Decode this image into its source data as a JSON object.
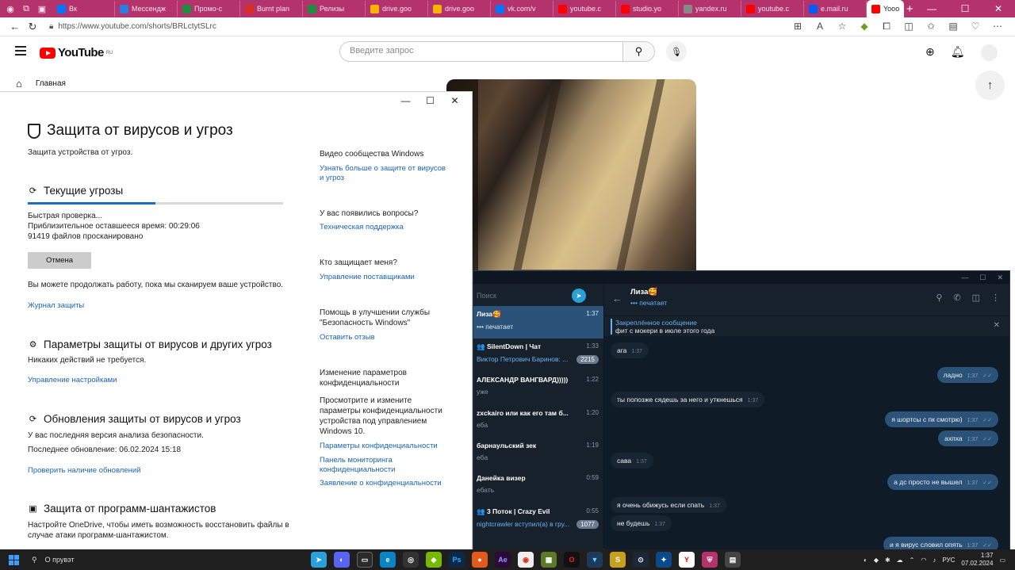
{
  "browser": {
    "tabs": [
      {
        "label": "Вк",
        "color": "#0077ff"
      },
      {
        "label": "Мессендж",
        "color": "#2a7de1"
      },
      {
        "label": "Промо-с",
        "color": "#1e8e3e"
      },
      {
        "label": "Burnt plan",
        "color": "#d93025"
      },
      {
        "label": "Релизы",
        "color": "#1e8e3e"
      },
      {
        "label": "drive.goo",
        "color": "#f4b400"
      },
      {
        "label": "drive.goo",
        "color": "#f4b400"
      },
      {
        "label": "vk.com/v",
        "color": "#0077ff"
      },
      {
        "label": "youtube.c",
        "color": "#ff0000"
      },
      {
        "label": "studio.yo",
        "color": "#ff0000"
      },
      {
        "label": "yandex.ru",
        "color": "#888888"
      },
      {
        "label": "youtube.c",
        "color": "#ff0000"
      },
      {
        "label": "e.mail.ru",
        "color": "#005ff9"
      }
    ],
    "active_tab": "Yooo",
    "url": "https://www.youtube.com/shorts/BRLctytSLrc"
  },
  "youtube": {
    "logo": "YouTube",
    "region": "RU",
    "search_placeholder": "Введите запрос",
    "home_label": "Главная"
  },
  "security": {
    "title": "Защита от вирусов и угроз",
    "subtitle": "Защита устройства от угроз.",
    "threats_heading": "Текущие угрозы",
    "scan_progress": 0.5,
    "scan_line1": "Быстрая проверка...",
    "scan_line2": "Приблизительное оставшееся время:  00:29:06",
    "scan_line3": "91419  файлов просканировано",
    "cancel_label": "Отмена",
    "continue_text": "Вы можете продолжать работу, пока мы сканируем ваше устройство.",
    "journal_link": "Журнал защиты",
    "settings_heading": "Параметры защиты от вирусов и других угроз",
    "settings_text": "Никаких действий не требуется.",
    "settings_link": "Управление настройками",
    "updates_heading": "Обновления защиты от вирусов и угроз",
    "updates_text1": "У вас последняя версия анализа безопасности.",
    "updates_text2": "Последнее обновление: 06.02.2024 15:18",
    "updates_link": "Проверить наличие обновлений",
    "ransom_heading": "Защита от программ-шантажистов",
    "ransom_text": "Настройте OneDrive, чтобы иметь возможность восстановить файлы в случае атаки программ-шантажистом.",
    "side": {
      "video_title": "Видео сообщества Windows",
      "video_link": "Узнать больше о защите от вирусов и угроз",
      "questions_title": "У вас появились вопросы?",
      "questions_link": "Техническая поддержка",
      "who_title": "Кто защищает меня?",
      "who_link": "Управление поставщиками",
      "help_title": "Помощь в улучшении службы \"Безопасность Windows\"",
      "help_link": "Оставить отзыв",
      "privacy_title": "Изменение параметров конфиденциальности",
      "privacy_text": "Просмотрите и измените параметры конфиденциальности устройства под управлением Windows 10.",
      "privacy_link1": "Параметры конфиденциальности",
      "privacy_link2": "Панель мониторинга конфиденциальности",
      "privacy_link3": "Заявление о конфиденциальности"
    }
  },
  "telegram": {
    "search_placeholder": "Поиск",
    "chats": [
      {
        "name": "Лиза🥰",
        "preview": "••• печатает",
        "time": "1:37",
        "badge": "",
        "selected": true
      },
      {
        "name": "👥 SilentDown | Чат",
        "preview": "Виктор Петрович Баринов: ...",
        "time": "1:33",
        "badge": "2215",
        "selected": false
      },
      {
        "name": "АЛЕКСАНДР ВАНГВАРД)))))",
        "preview": "уже",
        "time": "1:22",
        "badge": "",
        "selected": false
      },
      {
        "name": "zxckairo или как его там б...",
        "preview": "ебa",
        "time": "1:20",
        "badge": "",
        "selected": false
      },
      {
        "name": "барнаульский зек",
        "preview": "ебa",
        "time": "1:19",
        "badge": "",
        "selected": false
      },
      {
        "name": "Данейка визер",
        "preview": "ебать",
        "time": "0:59",
        "badge": "",
        "selected": false
      },
      {
        "name": "👥 3 Поток | Crazy Evil",
        "preview": "nightcrawler вступил(а) в гру...",
        "time": "0:55",
        "badge": "1077",
        "selected": false
      }
    ],
    "contact_name": "Лиза🥰",
    "contact_status": "••• печатает",
    "pinned_label": "Закреплённое сообщение",
    "pinned_text": "фит с мокери в июле этого года",
    "messages": [
      {
        "text": "ага",
        "time": "1:37",
        "dir": "in"
      },
      {
        "text": "ладно",
        "time": "1:37",
        "dir": "out"
      },
      {
        "text": "ты попозже сядешь за него и уткнешься",
        "time": "1:37",
        "dir": "in"
      },
      {
        "text": "я шортсы с пк смотрю)",
        "time": "1:37",
        "dir": "out"
      },
      {
        "text": "ахпха",
        "time": "1:37",
        "dir": "out"
      },
      {
        "text": "сава",
        "time": "1:37",
        "dir": "in"
      },
      {
        "text": "а дс просто не вышел",
        "time": "1:37",
        "dir": "out"
      },
      {
        "text": "я очень обижусь если спать",
        "time": "1:37",
        "dir": "in"
      },
      {
        "text": "не будешь",
        "time": "1:37",
        "dir": "in"
      },
      {
        "text": "и я вирус словил опять",
        "time": "1:37",
        "dir": "out"
      }
    ]
  },
  "taskbar": {
    "search_text": "О прувэт",
    "lang": "РУС",
    "time": "1:37",
    "date": "07.02.2024"
  }
}
